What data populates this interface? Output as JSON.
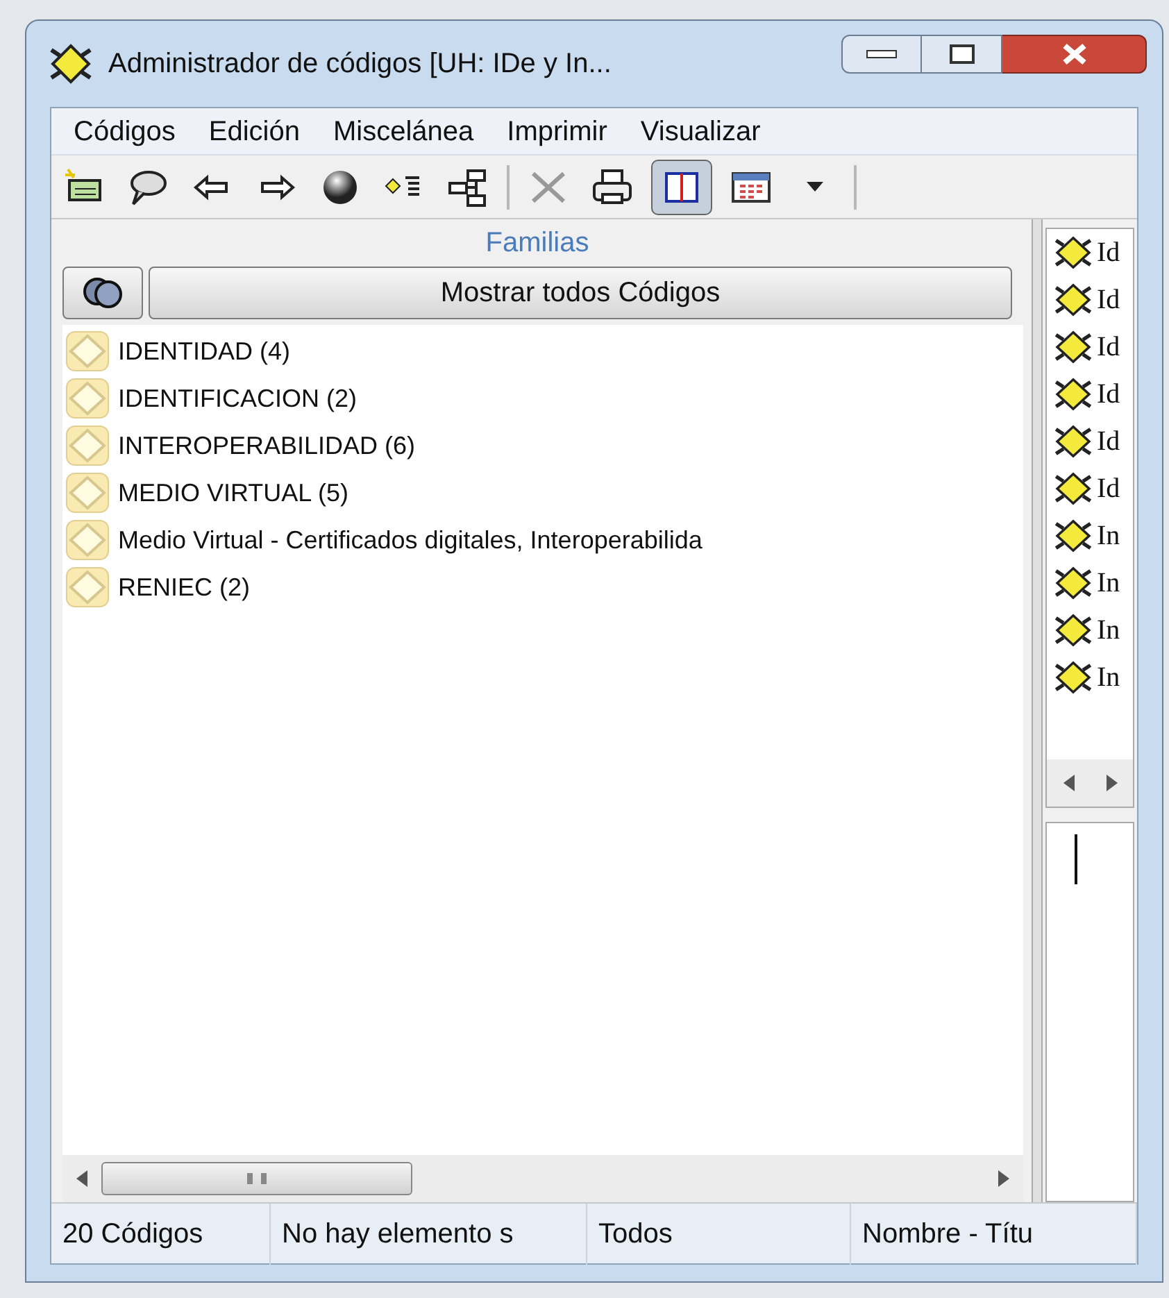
{
  "window": {
    "title": "Administrador de códigos [UH: IDe y In..."
  },
  "menu": [
    "Códigos",
    "Edición",
    "Miscelánea",
    "Imprimir",
    "Visualizar"
  ],
  "toolbar": [
    {
      "kind": "new-code",
      "pressed": false
    },
    {
      "kind": "comment",
      "pressed": false
    },
    {
      "kind": "back",
      "pressed": false
    },
    {
      "kind": "forward",
      "pressed": false
    },
    {
      "kind": "sphere",
      "pressed": false
    },
    {
      "kind": "code-list",
      "pressed": false
    },
    {
      "kind": "network",
      "pressed": false
    },
    {
      "kind": "separator"
    },
    {
      "kind": "delete",
      "pressed": false
    },
    {
      "kind": "print",
      "pressed": false
    },
    {
      "kind": "split-view",
      "pressed": true
    },
    {
      "kind": "table",
      "pressed": false
    },
    {
      "kind": "dropdown",
      "pressed": false
    },
    {
      "kind": "separator"
    }
  ],
  "families_panel": {
    "title": "Familias",
    "show_all_button": "Mostrar todos Códigos",
    "items": [
      {
        "label": "IDENTIDAD (4)"
      },
      {
        "label": "IDENTIFICACION (2)"
      },
      {
        "label": "INTEROPERABILIDAD (6)"
      },
      {
        "label": "MEDIO VIRTUAL (5)"
      },
      {
        "label": "Medio Virtual - Certificados digitales, Interoperabilida"
      },
      {
        "label": "RENIEC (2)"
      }
    ]
  },
  "codes_panel": {
    "items": [
      "Id",
      "Id",
      "Id",
      "Id",
      "Id",
      "Id",
      "In",
      "In",
      "In",
      "In"
    ]
  },
  "status_bar": [
    "20 Códigos",
    "No hay elemento s",
    "Todos",
    "Nombre - Títu"
  ]
}
